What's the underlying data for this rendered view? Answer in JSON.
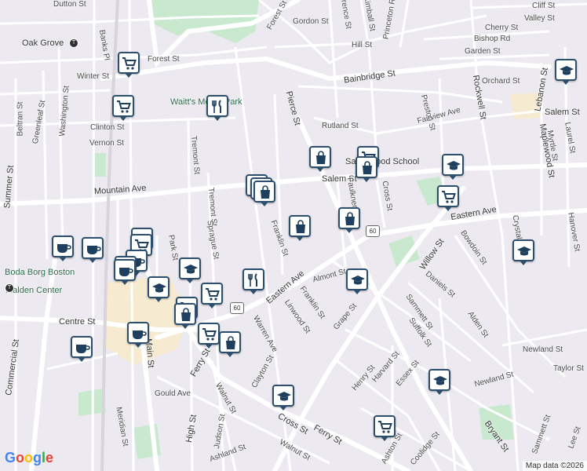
{
  "colors": {
    "land": "#eceaf0",
    "park": "#c9e9cf",
    "road": "#ffffff",
    "major_road": "#f6f4fa",
    "commercial": "#f6ead0",
    "pin_border": "#2d4f6e",
    "pin_icon": "#1e3f5e"
  },
  "streets": [
    {
      "text": "Dutton St"
    },
    {
      "text": "Oak Grove"
    },
    {
      "text": "Banks Pl"
    },
    {
      "text": "Forest St"
    },
    {
      "text": "Winter St"
    },
    {
      "text": "Forest St"
    },
    {
      "text": "Gordon St"
    },
    {
      "text": "Florence St"
    },
    {
      "text": "Kimball St"
    },
    {
      "text": "Princeton Rd"
    },
    {
      "text": "Hill St"
    },
    {
      "text": "Cherry St"
    },
    {
      "text": "Cliff St"
    },
    {
      "text": "Valley St"
    },
    {
      "text": "Bishop Rd"
    },
    {
      "text": "Garden St"
    },
    {
      "text": "Bainbridge St"
    },
    {
      "text": "Orchard St"
    },
    {
      "text": "Rockwell St"
    },
    {
      "text": "Lebanon St"
    },
    {
      "text": "Beltran St"
    },
    {
      "text": "Greenleaf St"
    },
    {
      "text": "Washington St"
    },
    {
      "text": "Clinton St"
    },
    {
      "text": "Vernon St"
    },
    {
      "text": "Pierce St"
    },
    {
      "text": "Rutland St"
    },
    {
      "text": "Preston St"
    },
    {
      "text": "Fairview Ave"
    },
    {
      "text": "Salem St"
    },
    {
      "text": "Maplewood St"
    },
    {
      "text": "Myrtle St"
    },
    {
      "text": "Laurel St"
    },
    {
      "text": "Summer St"
    },
    {
      "text": "Tremont St"
    },
    {
      "text": "Mountain Ave"
    },
    {
      "text": "Tremont St"
    },
    {
      "text": "Salem St"
    },
    {
      "text": "Faulkner St"
    },
    {
      "text": "Cross St"
    },
    {
      "text": "Eastern Ave"
    },
    {
      "text": "Crystal St"
    },
    {
      "text": "Hanover St"
    },
    {
      "text": "Sprague St"
    },
    {
      "text": "Franklin St"
    },
    {
      "text": "Park St"
    },
    {
      "text": "Willow St"
    },
    {
      "text": "Bowdoin St"
    },
    {
      "text": "Daniels St"
    },
    {
      "text": "Eastern Ave"
    },
    {
      "text": "Almont St"
    },
    {
      "text": "Linwood St"
    },
    {
      "text": "Franklin St"
    },
    {
      "text": "Grape St"
    },
    {
      "text": "Commercial St"
    },
    {
      "text": "Centre St"
    },
    {
      "text": "Malden Center"
    },
    {
      "text": "Main St"
    },
    {
      "text": "Warren Ave"
    },
    {
      "text": "Sammett St"
    },
    {
      "text": "Suffolk St"
    },
    {
      "text": "Alden St"
    },
    {
      "text": "Newland St"
    },
    {
      "text": "Newland St"
    },
    {
      "text": "Taylor St"
    },
    {
      "text": "Ferry St"
    },
    {
      "text": "Clayton St"
    },
    {
      "text": "Henry St"
    },
    {
      "text": "Harvard St"
    },
    {
      "text": "Essex St"
    },
    {
      "text": "Gould Ave"
    },
    {
      "text": "Walnut St"
    },
    {
      "text": "High St"
    },
    {
      "text": "Judson St"
    },
    {
      "text": "Cross St"
    },
    {
      "text": "Ferry St"
    },
    {
      "text": "Meridian St"
    },
    {
      "text": "Ashland St"
    },
    {
      "text": "Walnut St"
    },
    {
      "text": "Ashton St"
    },
    {
      "text": "Coolidge St"
    },
    {
      "text": "Bryant St"
    },
    {
      "text": "Sammett St"
    },
    {
      "text": "Lee St"
    },
    {
      "text": "Gordon St"
    },
    {
      "text": "Winter St"
    },
    {
      "text": "Essex St"
    },
    {
      "text": "Salem St"
    }
  ],
  "places": {
    "park": "Waitt's Mount Park",
    "school": "Salemwood School",
    "boda_borg": "Boda Borg Boston",
    "malden_center": "Malden Center"
  },
  "route_shields": [
    "60",
    "60"
  ],
  "attribution": {
    "logo": "Google",
    "copyright": "Map data ©2026"
  },
  "markers": [
    {
      "type": "grocery-icon"
    },
    {
      "type": "grocery-icon"
    },
    {
      "type": "fastfood-icon"
    },
    {
      "type": "school-icon"
    },
    {
      "type": "shopping-icon"
    },
    {
      "type": "grocery-icon"
    },
    {
      "type": "shopping-icon"
    },
    {
      "type": "school-icon"
    },
    {
      "type": "grocery-icon"
    },
    {
      "type": "shopping-icon"
    },
    {
      "type": "shopping-icon"
    },
    {
      "type": "shopping-icon"
    },
    {
      "type": "shopping-icon"
    },
    {
      "type": "shopping-icon"
    },
    {
      "type": "school-icon"
    },
    {
      "type": "cafe-icon"
    },
    {
      "type": "cafe-icon"
    },
    {
      "type": "cafe-icon"
    },
    {
      "type": "grocery-icon"
    },
    {
      "type": "cafe-icon"
    },
    {
      "type": "cafe-icon"
    },
    {
      "type": "cafe-icon"
    },
    {
      "type": "school-icon"
    },
    {
      "type": "school-icon"
    },
    {
      "type": "fastfood-icon"
    },
    {
      "type": "school-icon"
    },
    {
      "type": "grocery-icon"
    },
    {
      "type": "grocery-icon"
    },
    {
      "type": "shopping-icon"
    },
    {
      "type": "grocery-icon"
    },
    {
      "type": "shopping-icon"
    },
    {
      "type": "cafe-icon"
    },
    {
      "type": "cafe-icon"
    },
    {
      "type": "school-icon"
    },
    {
      "type": "school-icon"
    },
    {
      "type": "grocery-icon"
    }
  ]
}
